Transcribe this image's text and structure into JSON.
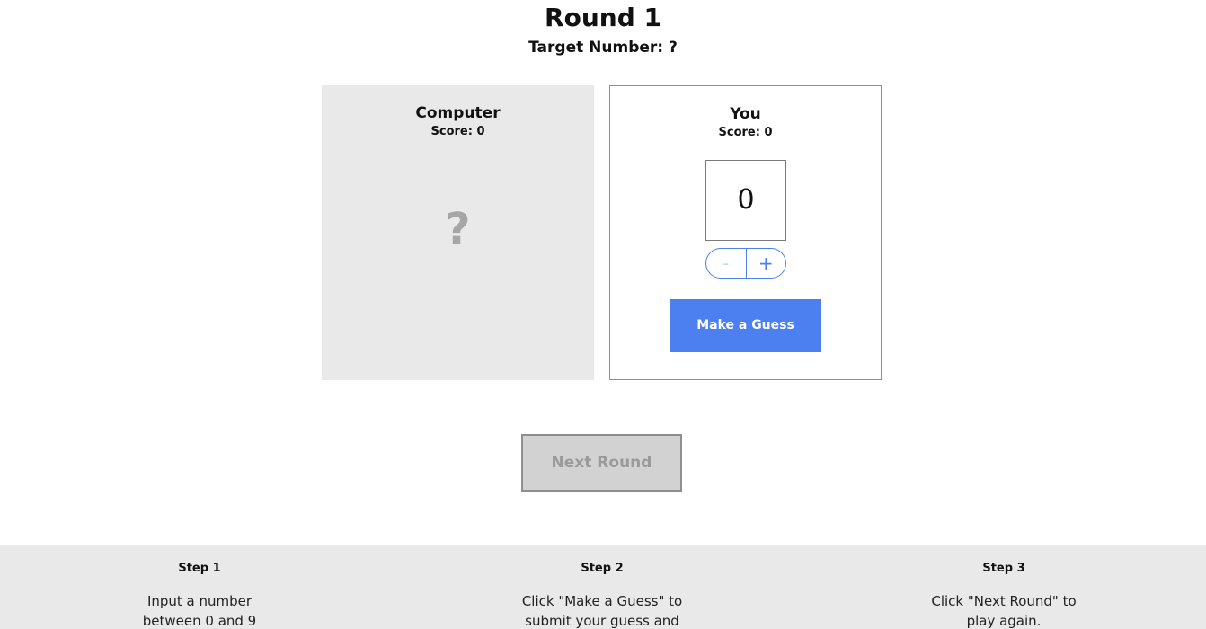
{
  "header": {
    "round_title": "Round 1",
    "target_line": "Target Number: ?"
  },
  "computer": {
    "name": "Computer",
    "score": "Score: 0",
    "guess": "?"
  },
  "human": {
    "name": "You",
    "score": "Score: 0",
    "guess_value": "0",
    "decrement_label": "-",
    "increment_label": "+",
    "guess_button_label": "Make a Guess"
  },
  "next_round_label": "Next Round",
  "colors": {
    "accent": "#4c7ff0",
    "panel_gray": "#e9e9e9",
    "disabled_gray": "#d2d2d2"
  },
  "instructions": [
    {
      "title": "Step 1",
      "lines": [
        "Input a number",
        "between 0 and 9"
      ]
    },
    {
      "title": "Step 2",
      "lines": [
        "Click \"Make a Guess\" to",
        "submit your guess and"
      ]
    },
    {
      "title": "Step 3",
      "lines": [
        "Click \"Next Round\" to",
        "play again."
      ]
    }
  ]
}
